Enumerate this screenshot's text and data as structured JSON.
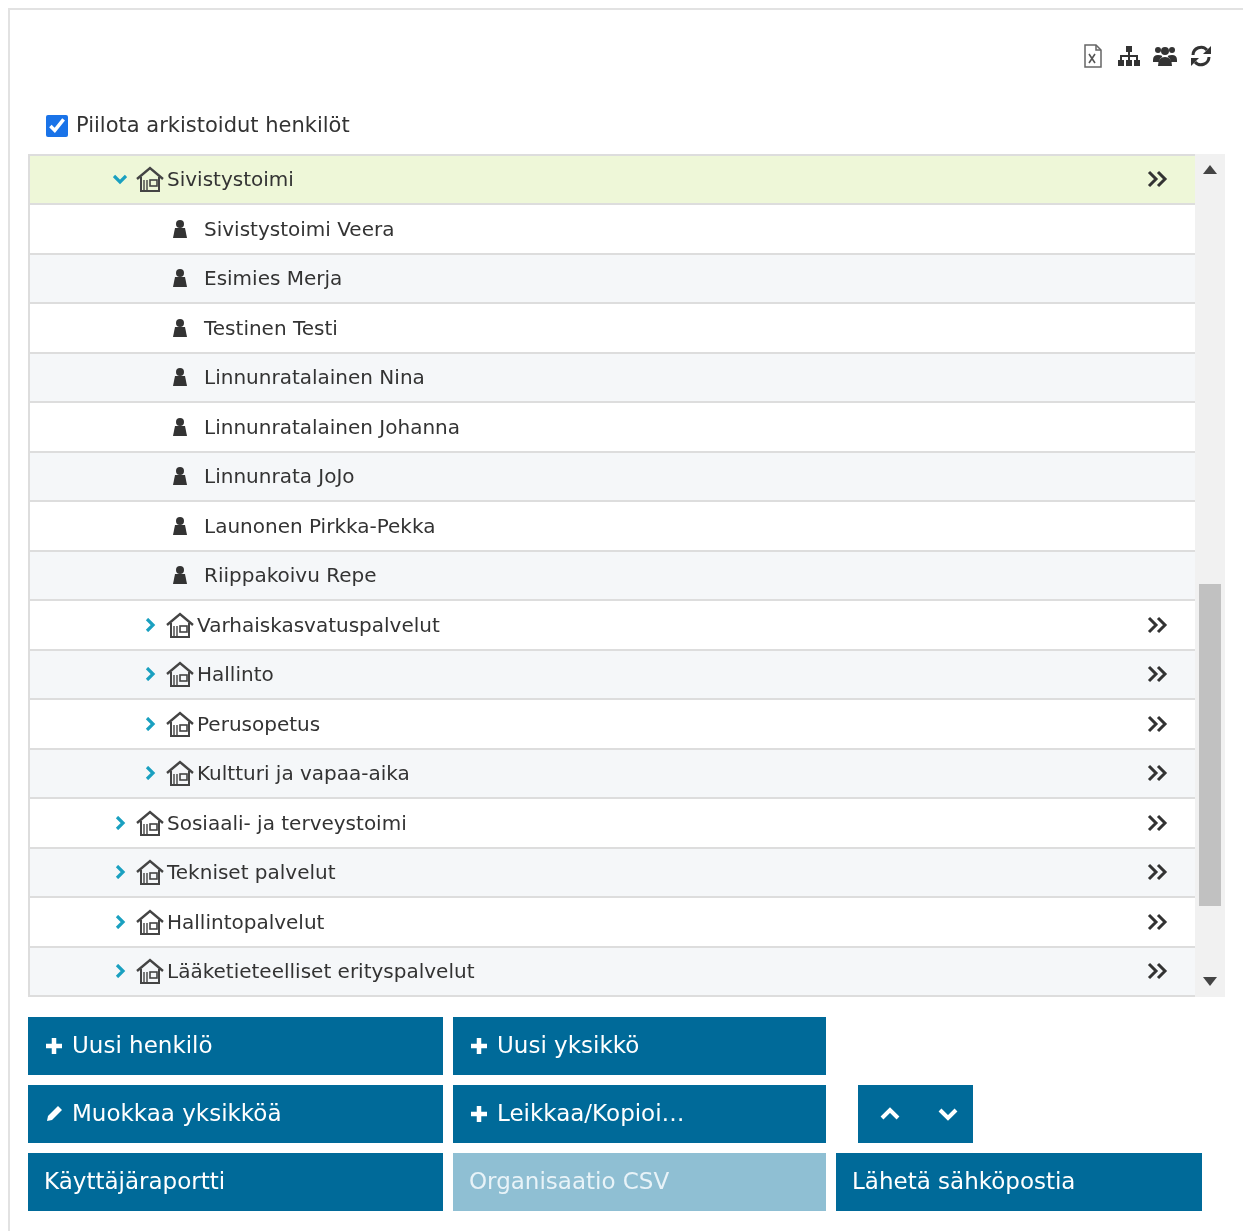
{
  "hide_archived": {
    "label": "Piilota arkistoidut henkilöt",
    "checked": true
  },
  "tree": [
    {
      "label": "Sivistystoimi",
      "kind": "unit",
      "expanded": true,
      "selected": true,
      "children": [
        {
          "label": "Sivistystoimi Veera",
          "kind": "person",
          "selected": false
        },
        {
          "label": "Esimies Merja",
          "kind": "person",
          "selected": false
        },
        {
          "label": "Testinen Testi",
          "kind": "person",
          "selected": false
        },
        {
          "label": "Linnunratalainen Nina",
          "kind": "person",
          "selected": false
        },
        {
          "label": "Linnunratalainen Johanna",
          "kind": "person",
          "selected": false
        },
        {
          "label": "Linnunrata JoJo",
          "kind": "person",
          "selected": false
        },
        {
          "label": "Launonen Pirkka-Pekka",
          "kind": "person",
          "selected": false
        },
        {
          "label": "Riippakoivu Repe",
          "kind": "person",
          "selected": false
        },
        {
          "label": "Varhaiskasvatuspalvelut",
          "kind": "unit",
          "expanded": false,
          "selected": false
        },
        {
          "label": "Hallinto",
          "kind": "unit",
          "expanded": false,
          "selected": false
        },
        {
          "label": "Perusopetus",
          "kind": "unit",
          "expanded": false,
          "selected": false
        },
        {
          "label": "Kultturi ja vapaa-aika",
          "kind": "unit",
          "expanded": false,
          "selected": false
        }
      ]
    },
    {
      "label": "Sosiaali- ja terveystoimi",
      "kind": "unit",
      "expanded": false,
      "selected": false
    },
    {
      "label": "Tekniset palvelut",
      "kind": "unit",
      "expanded": false,
      "selected": false
    },
    {
      "label": "Hallintopalvelut",
      "kind": "unit",
      "expanded": false,
      "selected": false
    },
    {
      "label": "Lääketieteelliset erityspalvelut",
      "kind": "unit",
      "expanded": false,
      "selected": false
    }
  ],
  "button_rows": [
    [
      {
        "kind": "add",
        "label": "Uusi henkilö",
        "disabled": false
      },
      {
        "kind": "add",
        "label": "Uusi yksikkö",
        "disabled": false
      }
    ],
    [
      {
        "kind": "edit",
        "label": "Muokkaa yksikköä",
        "disabled": false
      },
      {
        "kind": "add",
        "label": "Leikkaa/Kopioi…",
        "disabled": false
      },
      {
        "kind": "up",
        "disabled": false
      },
      {
        "kind": "down",
        "disabled": false
      }
    ],
    [
      {
        "kind": "plain",
        "label": "Käyttäjäraportti",
        "disabled": false
      },
      {
        "kind": "plain",
        "label": "Organisaatio CSV",
        "disabled": true
      },
      {
        "kind": "plain",
        "label": "Lähetä sähköpostia",
        "disabled": false
      }
    ]
  ]
}
